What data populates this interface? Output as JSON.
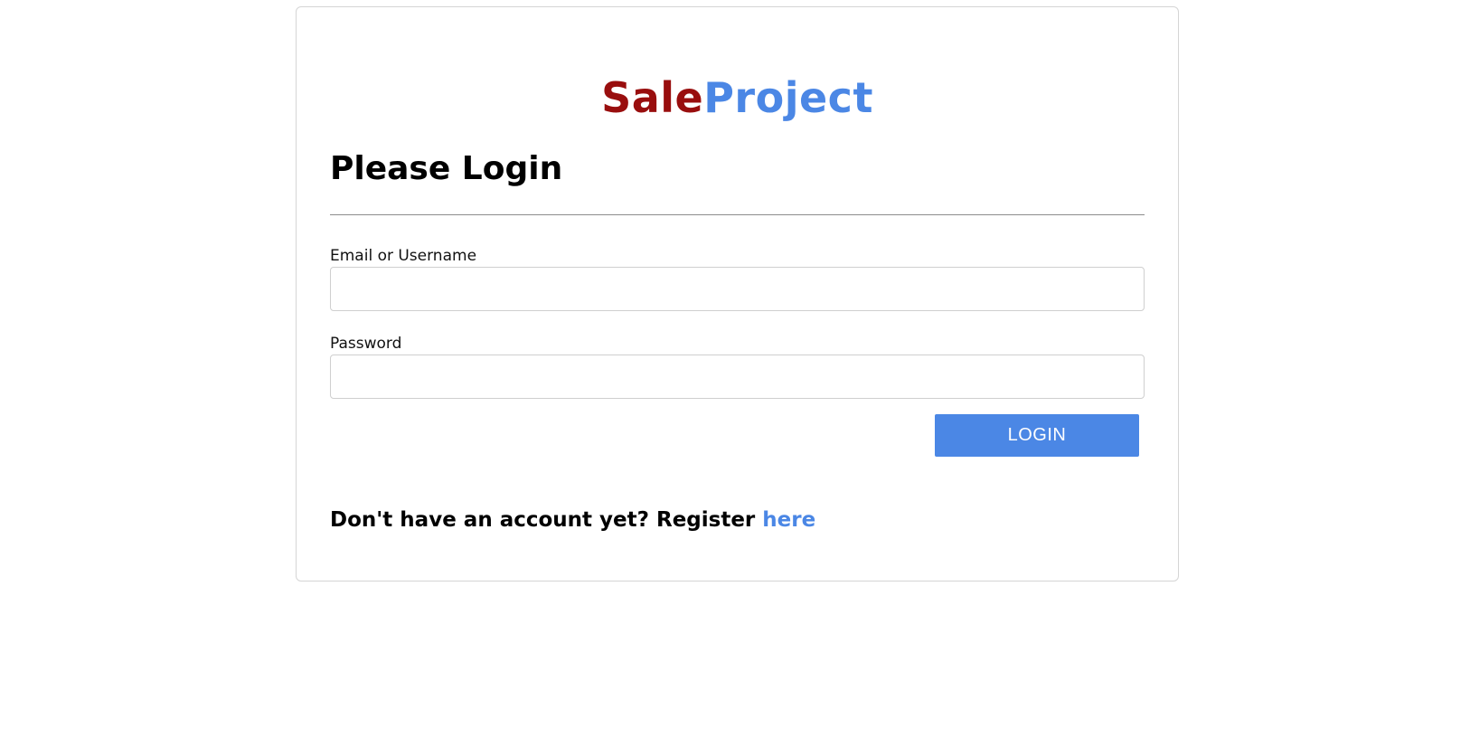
{
  "brand": {
    "part_a": "Sale",
    "part_b": "Project",
    "color_a": "#990e0e",
    "color_b": "#4b87e5"
  },
  "login_form": {
    "title": "Please Login",
    "email_label": "Email or Username",
    "email_value": "",
    "password_label": "Password",
    "password_value": "",
    "submit_label": "LOGIN",
    "accent_color": "#4b87e5"
  },
  "register": {
    "prompt": "Don't have an account yet? Register ",
    "link_label": "here"
  }
}
